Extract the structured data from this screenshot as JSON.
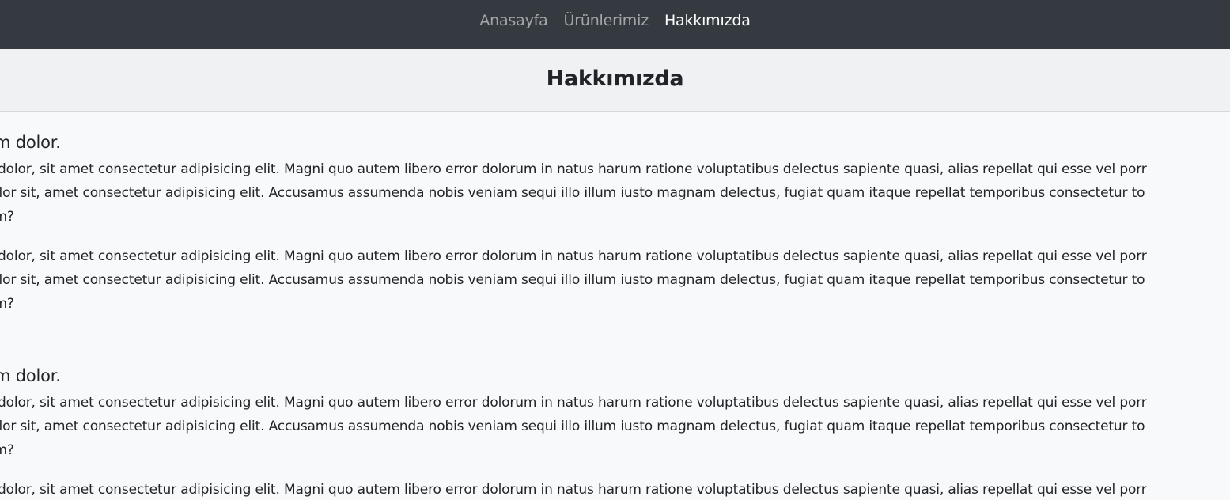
{
  "nav": {
    "items": [
      {
        "label": "Anasayfa",
        "active": false
      },
      {
        "label": "Ürünlerimiz",
        "active": false
      },
      {
        "label": "Hakkımızda",
        "active": true
      }
    ]
  },
  "header": {
    "title": "Hakkımızda"
  },
  "sections": [
    {
      "heading": "psum dolor.",
      "paragraphs": [
        {
          "line1": "sum dolor, sit amet consectetur adipisicing elit. Magni quo autem libero error dolorum in natus harum ratione voluptatibus delectus sapiente quasi, alias repellat qui esse vel porr",
          "line2": "m dolor sit, amet consectetur adipisicing elit. Accusamus assumenda nobis veniam sequi illo illum iusto magnam delectus, fugiat quam itaque repellat temporibus consectetur to",
          "line3": "o eum?"
        },
        {
          "line1": "sum dolor, sit amet consectetur adipisicing elit. Magni quo autem libero error dolorum in natus harum ratione voluptatibus delectus sapiente quasi, alias repellat qui esse vel porr",
          "line2": "m dolor sit, amet consectetur adipisicing elit. Accusamus assumenda nobis veniam sequi illo illum iusto magnam delectus, fugiat quam itaque repellat temporibus consectetur to",
          "line3": "o eum?"
        }
      ]
    },
    {
      "heading": "psum dolor.",
      "paragraphs": [
        {
          "line1": "sum dolor, sit amet consectetur adipisicing elit. Magni quo autem libero error dolorum in natus harum ratione voluptatibus delectus sapiente quasi, alias repellat qui esse vel porr",
          "line2": "m dolor sit, amet consectetur adipisicing elit. Accusamus assumenda nobis veniam sequi illo illum iusto magnam delectus, fugiat quam itaque repellat temporibus consectetur to",
          "line3": "o eum?"
        },
        {
          "line1": "sum dolor, sit amet consectetur adipisicing elit. Magni quo autem libero error dolorum in natus harum ratione voluptatibus delectus sapiente quasi, alias repellat qui esse vel porr",
          "line2": "",
          "line3": ""
        }
      ]
    }
  ]
}
